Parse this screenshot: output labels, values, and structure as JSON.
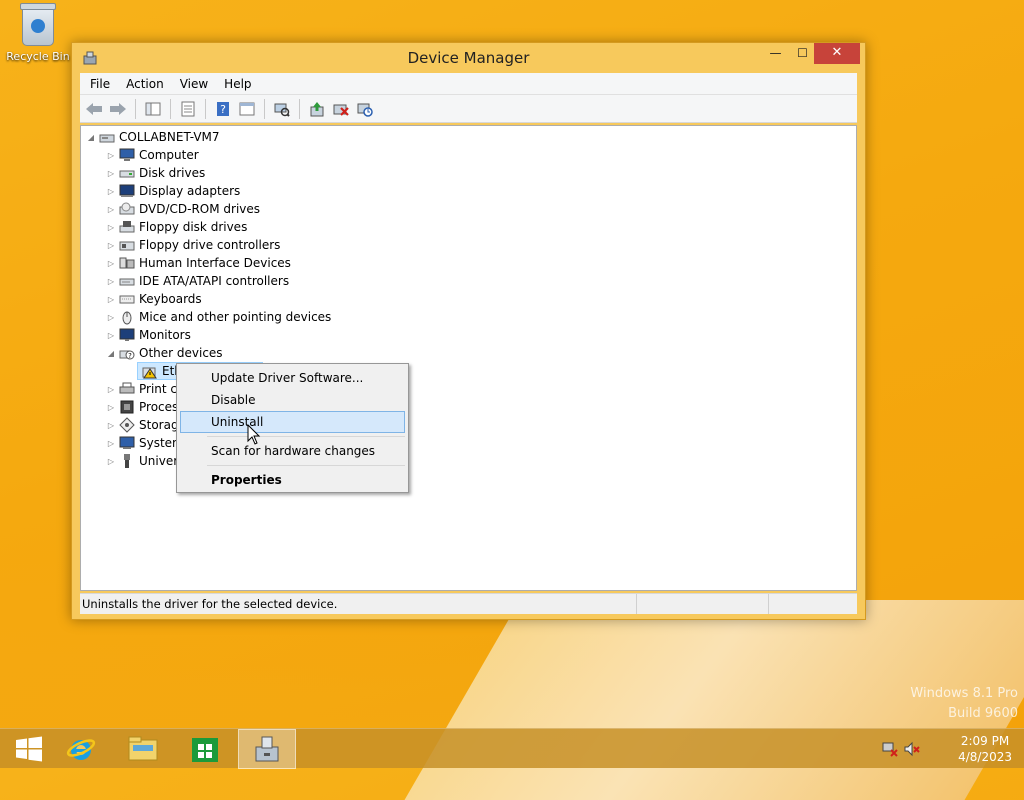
{
  "desktop": {
    "recycle_bin_label": "Recycle Bin",
    "watermark_line1": "Windows 8.1 Pro",
    "watermark_line2": "Build 9600"
  },
  "window": {
    "title": "Device Manager",
    "buttons": {
      "minimize": "—",
      "maximize": "☐",
      "close": "✕"
    },
    "menu": [
      "File",
      "Action",
      "View",
      "Help"
    ],
    "toolbar_icons": [
      "back-icon",
      "forward-icon",
      "show-hide-console-tree-icon",
      "properties-icon",
      "help-icon",
      "action-pane-icon",
      "scan-hardware-icon",
      "update-driver-icon",
      "uninstall-icon",
      "disable-icon"
    ]
  },
  "tree": {
    "root": "COLLABNET-VM7",
    "categories": [
      {
        "label": "Computer",
        "icon": "computer-icon"
      },
      {
        "label": "Disk drives",
        "icon": "disk-drive-icon"
      },
      {
        "label": "Display adapters",
        "icon": "display-adapter-icon"
      },
      {
        "label": "DVD/CD-ROM drives",
        "icon": "dvd-drive-icon"
      },
      {
        "label": "Floppy disk drives",
        "icon": "floppy-drive-icon"
      },
      {
        "label": "Floppy drive controllers",
        "icon": "floppy-controller-icon"
      },
      {
        "label": "Human Interface Devices",
        "icon": "hid-icon"
      },
      {
        "label": "IDE ATA/ATAPI controllers",
        "icon": "ide-controller-icon"
      },
      {
        "label": "Keyboards",
        "icon": "keyboard-icon"
      },
      {
        "label": "Mice and other pointing devices",
        "icon": "mouse-icon"
      },
      {
        "label": "Monitors",
        "icon": "monitor-icon"
      },
      {
        "label": "Other devices",
        "icon": "unknown-device-icon"
      },
      {
        "label": "Eth",
        "icon": "warning-device-icon"
      },
      {
        "label": "Print c",
        "icon": "printer-icon"
      },
      {
        "label": "Proces",
        "icon": "processor-icon"
      },
      {
        "label": "Storag",
        "icon": "storage-icon"
      },
      {
        "label": "System",
        "icon": "system-icon"
      },
      {
        "label": "Univer",
        "icon": "usb-icon"
      }
    ]
  },
  "context_menu": {
    "items": [
      "Update Driver Software...",
      "Disable",
      "Uninstall",
      "Scan for hardware changes",
      "Properties"
    ],
    "hovered": "Uninstall"
  },
  "status_bar": {
    "text": "Uninstalls the driver for the selected device."
  },
  "taskbar": {
    "apps": [
      "start-icon",
      "internet-explorer-icon",
      "file-explorer-icon",
      "store-icon",
      "device-manager-icon"
    ],
    "clock_time": "2:09 PM",
    "clock_date": "4/8/2023"
  }
}
